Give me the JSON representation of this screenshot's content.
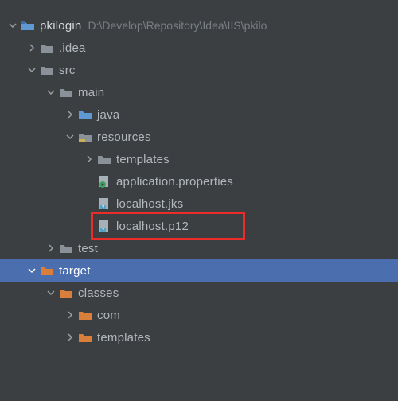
{
  "project": {
    "name": "pkilogin",
    "path_hint": "D:\\Develop\\Repository\\Idea\\IIS\\pkilo"
  },
  "tree": {
    "idea": ".idea",
    "src": "src",
    "main": "main",
    "java": "java",
    "resources": "resources",
    "templates": "templates",
    "appprops": "application.properties",
    "localhost_jks": "localhost.jks",
    "localhost_p12": "localhost.p12",
    "test": "test",
    "target": "target",
    "classes": "classes",
    "com": "com",
    "templates2": "templates"
  },
  "colors": {
    "folder_blue": "#5E99D2",
    "folder_gray": "#8A9199",
    "folder_orange": "#D97E3B",
    "resources_bar": "#C9B15A",
    "selection": "#4B6EAF",
    "highlight": "#ED2B28",
    "file_badge": "#3F9E63",
    "file_badge2": "#55A3C4"
  }
}
